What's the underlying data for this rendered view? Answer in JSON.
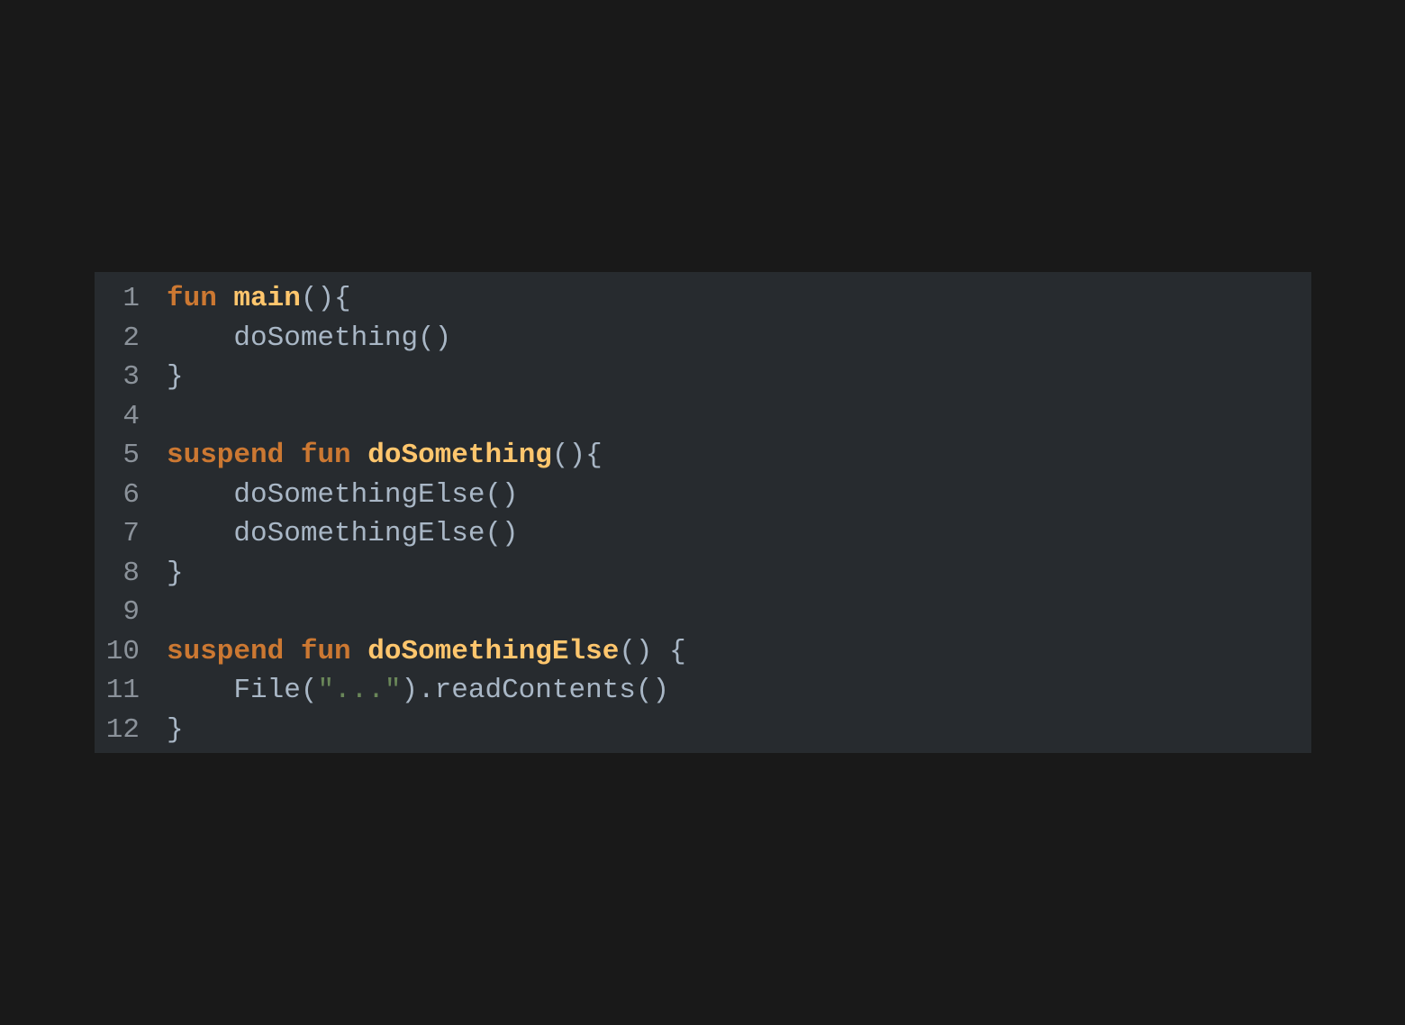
{
  "editor": {
    "colors": {
      "background": "#191919",
      "panel": "#272b2f",
      "keyword": "#cc7832",
      "function_name": "#ffc66d",
      "string": "#6a8759",
      "text": "#a9b7c6",
      "line_number": "#8b929a"
    },
    "lines": [
      {
        "number": "1",
        "tokens": [
          {
            "t": "fun",
            "k": "kw"
          },
          {
            "t": " ",
            "k": "plain"
          },
          {
            "t": "main",
            "k": "fn"
          },
          {
            "t": "(){",
            "k": "plain"
          }
        ]
      },
      {
        "number": "2",
        "tokens": [
          {
            "t": "    doSomething()",
            "k": "plain"
          }
        ]
      },
      {
        "number": "3",
        "tokens": [
          {
            "t": "}",
            "k": "plain"
          }
        ]
      },
      {
        "number": "4",
        "tokens": []
      },
      {
        "number": "5",
        "tokens": [
          {
            "t": "suspend",
            "k": "kw"
          },
          {
            "t": " ",
            "k": "plain"
          },
          {
            "t": "fun",
            "k": "kw"
          },
          {
            "t": " ",
            "k": "plain"
          },
          {
            "t": "doSomething",
            "k": "fn"
          },
          {
            "t": "(){",
            "k": "plain"
          }
        ]
      },
      {
        "number": "6",
        "tokens": [
          {
            "t": "    doSomethingElse()",
            "k": "plain"
          }
        ]
      },
      {
        "number": "7",
        "tokens": [
          {
            "t": "    doSomethingElse()",
            "k": "plain"
          }
        ]
      },
      {
        "number": "8",
        "tokens": [
          {
            "t": "}",
            "k": "plain"
          }
        ]
      },
      {
        "number": "9",
        "tokens": []
      },
      {
        "number": "10",
        "tokens": [
          {
            "t": "suspend",
            "k": "kw"
          },
          {
            "t": " ",
            "k": "plain"
          },
          {
            "t": "fun",
            "k": "kw"
          },
          {
            "t": " ",
            "k": "plain"
          },
          {
            "t": "doSomethingElse",
            "k": "fn"
          },
          {
            "t": "() {",
            "k": "plain"
          }
        ]
      },
      {
        "number": "11",
        "tokens": [
          {
            "t": "    File(",
            "k": "plain"
          },
          {
            "t": "\"...\"",
            "k": "str"
          },
          {
            "t": ").readContents()",
            "k": "plain"
          }
        ]
      },
      {
        "number": "12",
        "tokens": [
          {
            "t": "}",
            "k": "plain"
          }
        ]
      }
    ]
  }
}
